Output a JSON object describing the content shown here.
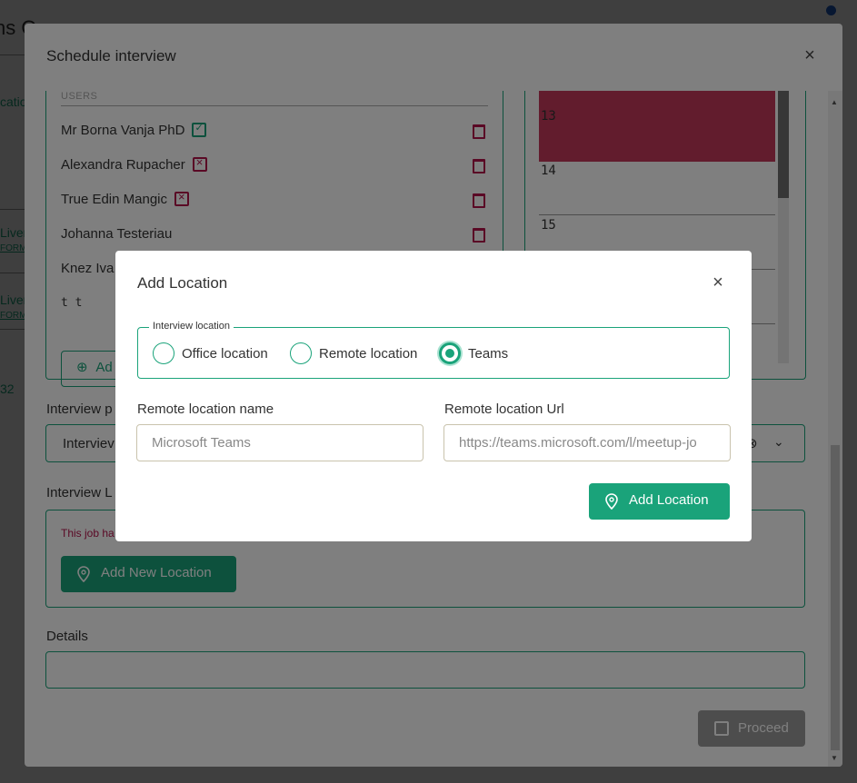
{
  "background": {
    "title_fragment": "ns Q",
    "side_fragments": [
      "catio",
      "Liver",
      "FORM",
      "Liver",
      "FORM",
      "32"
    ]
  },
  "schedule_modal": {
    "title": "Schedule interview",
    "users_header": "USERS",
    "users": [
      {
        "name": "Mr Borna Vanja PhD",
        "status": "available"
      },
      {
        "name": "Alexandra Rupacher",
        "status": "unavailable"
      },
      {
        "name": "True Edin Mangic",
        "status": "unavailable"
      },
      {
        "name": "Johanna Testeriau",
        "status": "none"
      },
      {
        "name": "Knez Iva",
        "status": "none"
      },
      {
        "name": "t t",
        "status": "none"
      }
    ],
    "add_user_label": "Ad",
    "calendar_hours": [
      "13",
      "14",
      "15"
    ],
    "interview_p_label": "Interview p",
    "interview_p_value": "Interviev",
    "interview_l_label": "Interview L",
    "location_note": "This job ha",
    "add_new_location_label": "Add New Location",
    "details_label": "Details",
    "proceed_label": "Proceed"
  },
  "add_location_modal": {
    "title": "Add Location",
    "legend": "Interview location",
    "options": [
      "Office location",
      "Remote location",
      "Teams"
    ],
    "selected_option": "Teams",
    "remote_name_label": "Remote location name",
    "remote_name_placeholder": "Microsoft Teams",
    "remote_url_label": "Remote location Url",
    "remote_url_placeholder": "https://teams.microsoft.com/l/meetup-jo",
    "add_button_label": "Add Location"
  },
  "colors": {
    "accent": "#1aa37a",
    "danger": "#b5124b",
    "busy_slot": "#c4395a"
  }
}
